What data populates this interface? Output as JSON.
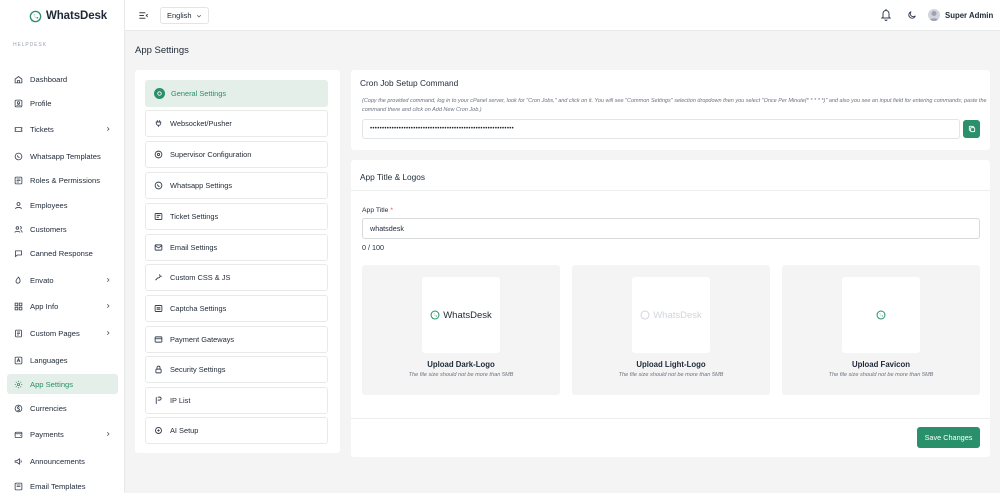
{
  "brand": {
    "name": "WhatsDesk"
  },
  "sidebar": {
    "section_label": "HELPDESK",
    "items": [
      {
        "label": "Dashboard",
        "icon": "home-icon"
      },
      {
        "label": "Profile",
        "icon": "profile-icon"
      },
      {
        "label": "Tickets",
        "icon": "ticket-icon",
        "has_submenu": true
      },
      {
        "label": "Whatsapp Templates",
        "icon": "whatsapp-icon"
      },
      {
        "label": "Roles & Permissions",
        "icon": "list-icon"
      },
      {
        "label": "Employees",
        "icon": "user-icon"
      },
      {
        "label": "Customers",
        "icon": "users-icon"
      },
      {
        "label": "Canned Response",
        "icon": "chat-icon"
      },
      {
        "label": "Envato",
        "icon": "envato-icon",
        "has_submenu": true
      },
      {
        "label": "App Info",
        "icon": "grid-icon",
        "has_submenu": true
      },
      {
        "label": "Custom Pages",
        "icon": "pages-icon",
        "has_submenu": true
      },
      {
        "label": "Languages",
        "icon": "language-icon"
      },
      {
        "label": "App Settings",
        "icon": "settings-icon",
        "active": true
      },
      {
        "label": "Currencies",
        "icon": "currency-icon"
      },
      {
        "label": "Payments",
        "icon": "wallet-icon",
        "has_submenu": true
      },
      {
        "label": "Announcements",
        "icon": "megaphone-icon"
      },
      {
        "label": "Email Templates",
        "icon": "email-template-icon"
      }
    ]
  },
  "topbar": {
    "language": "English",
    "user_name": "Super Admin"
  },
  "page": {
    "title": "App Settings"
  },
  "settings_nav": {
    "items": [
      {
        "label": "General Settings",
        "icon": "general-icon",
        "active": true
      },
      {
        "label": "Websocket/Pusher",
        "icon": "plug-icon"
      },
      {
        "label": "Supervisor Configuration",
        "icon": "supervisor-icon"
      },
      {
        "label": "Whatsapp Settings",
        "icon": "whatsapp-icon"
      },
      {
        "label": "Ticket Settings",
        "icon": "ticket-icon"
      },
      {
        "label": "Email Settings",
        "icon": "email-icon"
      },
      {
        "label": "Custom CSS & JS",
        "icon": "code-icon"
      },
      {
        "label": "Captcha Settings",
        "icon": "captcha-icon"
      },
      {
        "label": "Payment Gateways",
        "icon": "card-icon"
      },
      {
        "label": "Security Settings",
        "icon": "lock-icon"
      },
      {
        "label": "IP List",
        "icon": "ip-icon"
      },
      {
        "label": "AI Setup",
        "icon": "ai-icon"
      }
    ]
  },
  "cron": {
    "title": "Cron Job Setup Command",
    "hint": "(Copy the provided command, log in to your cPanel server, look for \"Cron Jobs,\" and click on it. You will see \"Common Settings\" selection dropdown then you select \"Once Per Minute(* * * * *)\" and also you see an input field for entering commands; paste the command there and click on Add New Cron Job.)",
    "command_masked": "••••••••••••••••••••••••••••••••••••••••••••••••••••••••••••"
  },
  "app_title": {
    "section_title": "App Title & Logos",
    "field_label": "App Title",
    "required_mark": "*",
    "value": "whatsdesk",
    "counter": "0 / 100"
  },
  "uploads": [
    {
      "title": "Upload Dark-Logo",
      "note": "The file size should not be more than 5MB",
      "preview_text": "WhatsDesk",
      "preview_color": "#1f2937"
    },
    {
      "title": "Upload Light-Logo",
      "note": "The file size should not be more than 5MB",
      "preview_text": "WhatsDesk",
      "preview_color": "#d1d5db"
    },
    {
      "title": "Upload Favicon",
      "note": "The file size should not be more than 5MB"
    }
  ],
  "actions": {
    "save_label": "Save Changes"
  },
  "colors": {
    "accent": "#2a8f6b",
    "active_bg": "#e4efe9",
    "background": "#f3f4f3"
  }
}
